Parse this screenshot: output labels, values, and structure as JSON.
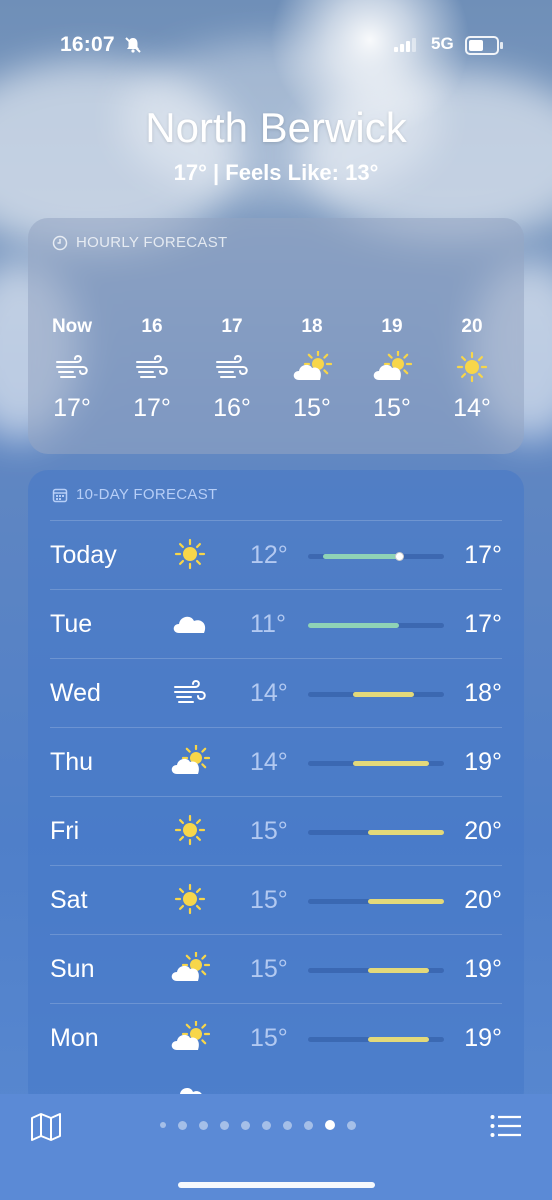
{
  "status_bar": {
    "time": "16:07",
    "network": "5G"
  },
  "location": {
    "city": "North Berwick",
    "summary": "17°  |  Feels Like: 13°"
  },
  "hourly": {
    "header": "HOURLY FORECAST",
    "items": [
      {
        "time": "Now",
        "icon": "wind-icon",
        "temp": "17°"
      },
      {
        "time": "16",
        "icon": "wind-icon",
        "temp": "17°"
      },
      {
        "time": "17",
        "icon": "wind-icon",
        "temp": "16°"
      },
      {
        "time": "18",
        "icon": "partly-sunny-icon",
        "temp": "15°"
      },
      {
        "time": "19",
        "icon": "partly-sunny-icon",
        "temp": "15°"
      },
      {
        "time": "20",
        "icon": "sun-icon",
        "temp": "14°"
      }
    ]
  },
  "daily": {
    "header": "10-DAY FORECAST",
    "range_min": 11,
    "range_max": 20,
    "current_temp": 17,
    "days": [
      {
        "day": "Today",
        "icon": "sun-icon",
        "low": "12°",
        "high": "17°",
        "low_val": 12,
        "high_val": 17
      },
      {
        "day": "Tue",
        "icon": "cloud-icon",
        "low": "11°",
        "high": "17°",
        "low_val": 11,
        "high_val": 17
      },
      {
        "day": "Wed",
        "icon": "wind-icon",
        "low": "14°",
        "high": "18°",
        "low_val": 14,
        "high_val": 18
      },
      {
        "day": "Thu",
        "icon": "partly-sunny-icon",
        "low": "14°",
        "high": "19°",
        "low_val": 14,
        "high_val": 19
      },
      {
        "day": "Fri",
        "icon": "sun-icon",
        "low": "15°",
        "high": "20°",
        "low_val": 15,
        "high_val": 20
      },
      {
        "day": "Sat",
        "icon": "sun-icon",
        "low": "15°",
        "high": "20°",
        "low_val": 15,
        "high_val": 20
      },
      {
        "day": "Sun",
        "icon": "partly-sunny-icon",
        "low": "15°",
        "high": "19°",
        "low_val": 15,
        "high_val": 19
      },
      {
        "day": "Mon",
        "icon": "partly-sunny-icon",
        "low": "15°",
        "high": "19°",
        "low_val": 15,
        "high_val": 19
      }
    ]
  },
  "pager": {
    "count": 10,
    "active_index": 8
  },
  "colors": {
    "bar_cool": "#8fd3b6",
    "bar_warm": "#e3d97a",
    "sun": "#f7d64a"
  }
}
